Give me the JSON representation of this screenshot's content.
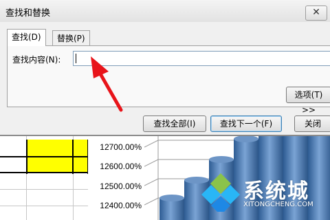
{
  "dialog": {
    "title": "查找和替换",
    "close_glyph": "✕",
    "tabs": [
      {
        "label": "查找(D)",
        "active": true
      },
      {
        "label": "替换(P)",
        "active": false
      }
    ],
    "find_label": "查找内容(N):",
    "find_value": "",
    "options_button": "选项(T) >>",
    "buttons": {
      "find_all": "查找全部(I)",
      "find_next": "查找下一个(F)",
      "close": "关闭"
    }
  },
  "chart": {
    "y_ticks": [
      "12700.00%",
      "12600.00%",
      "12500.00%",
      "12400.00%"
    ],
    "bar_color": "#4f81bd"
  },
  "annotation": {
    "arrow_color": "#e8141a"
  },
  "watermark": {
    "text": "系统城",
    "url": "XITONGCHENG.COM"
  },
  "colors": {
    "dialog_bg": "#f0f0f0",
    "cell_highlight": "#ffff00"
  }
}
